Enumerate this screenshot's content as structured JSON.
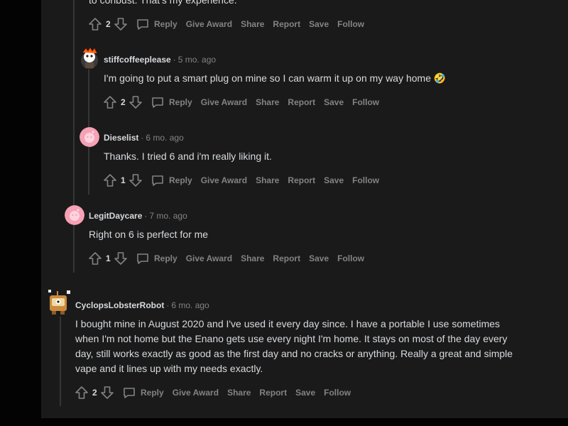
{
  "top_fragment": {
    "text": "to conbust. That's my experience.",
    "actions": {
      "score": "2",
      "reply": "Reply",
      "give_award": "Give Award",
      "share": "Share",
      "report": "Report",
      "save": "Save",
      "follow": "Follow"
    }
  },
  "comments": [
    {
      "username": "stiffcoffeeplease",
      "time": "5 mo. ago",
      "text": "I'm going to put a smart plug on mine so I can warm it up on my way home 🤣",
      "actions": {
        "score": "2",
        "reply": "Reply",
        "give_award": "Give Award",
        "share": "Share",
        "report": "Report",
        "save": "Save",
        "follow": "Follow"
      }
    },
    {
      "username": "Dieselist",
      "time": "6 mo. ago",
      "text": "Thanks. I tried 6 and i'm really liking it.",
      "actions": {
        "score": "1",
        "reply": "Reply",
        "give_award": "Give Award",
        "share": "Share",
        "report": "Report",
        "save": "Save",
        "follow": "Follow"
      }
    },
    {
      "username": "LegitDaycare",
      "time": "7 mo. ago",
      "text": "Right on 6 is perfect for me",
      "actions": {
        "score": "1",
        "reply": "Reply",
        "give_award": "Give Award",
        "share": "Share",
        "report": "Report",
        "save": "Save",
        "follow": "Follow"
      }
    },
    {
      "username": "CyclopsLobsterRobot",
      "time": "6 mo. ago",
      "text_lines": [
        "I bought mine in August 2020 and I've used it every day since. I have a portable I use sometimes",
        "when I'm not home but the Enano gets use every night I'm home. It stays on most of the day every",
        "day, still works exactly as good as the first day and no cracks or anything. Really a great and simple",
        "vape and it lines up with my needs exactly."
      ],
      "actions": {
        "score": "2",
        "reply": "Reply",
        "give_award": "Give Award",
        "share": "Share",
        "report": "Report",
        "save": "Save",
        "follow": "Follow"
      }
    }
  ],
  "colors": {
    "background": "#030303",
    "panel": "#1a1a1b",
    "thread_line": "#343536",
    "text": "#d7dadc",
    "muted": "#818384",
    "avatar_pink": "#f7a1b5"
  }
}
